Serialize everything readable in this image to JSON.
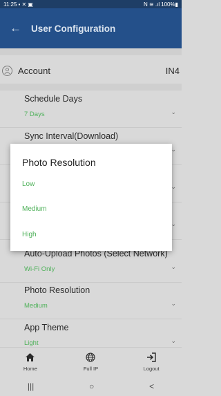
{
  "status_bar": {
    "time": "11:25",
    "left_icons": "▪ ✕ ▣",
    "right_icons": "N ≋ .ıl",
    "battery": "100%▮"
  },
  "app_bar": {
    "back_icon": "←",
    "title": "User Configuration"
  },
  "account": {
    "label": "Account",
    "value": "IN4"
  },
  "settings": [
    {
      "name": "Schedule Days",
      "value": "7 Days"
    },
    {
      "name": "Sync Interval(Download)",
      "value": ""
    },
    {
      "name": "",
      "value": ""
    },
    {
      "name": "",
      "value": ""
    },
    {
      "name": "Auto-Upload Photos (Select Network)",
      "value": "Wi-Fi Only"
    },
    {
      "name": "Photo Resolution",
      "value": "Medium"
    },
    {
      "name": "App Theme",
      "value": "Light"
    }
  ],
  "bottom_nav": [
    {
      "label": "Home",
      "icon": "home-icon"
    },
    {
      "label": "Full IP",
      "icon": "globe-icon"
    },
    {
      "label": "Logout",
      "icon": "logout-icon"
    }
  ],
  "system_nav": {
    "recents": "|||",
    "home": "○",
    "back": "<"
  },
  "dialog": {
    "title": "Photo Resolution",
    "options": [
      "Low",
      "Medium",
      "High"
    ],
    "accent_color": "#4fb15a"
  },
  "colors": {
    "app_bar": "#24508a",
    "status_bar": "#1e3e66",
    "accent": "#4fb15a"
  }
}
